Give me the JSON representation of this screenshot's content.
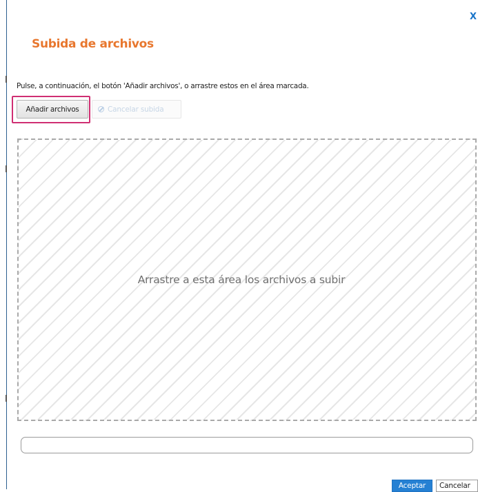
{
  "dialog": {
    "close_label": "X",
    "title": "Subida de archivos",
    "instructions": "Pulse, a continuación, el botón 'Añadir archivos', o arrastre estos en el área marcada."
  },
  "toolbar": {
    "add_files_label": "Añadir archivos",
    "cancel_upload_label": "Cancelar subida",
    "cancel_upload_icon": "ban-icon"
  },
  "dropzone": {
    "label": "Arrastre a esta área los archivos a subir"
  },
  "progress": {
    "value": 0
  },
  "footer": {
    "accept_label": "Aceptar",
    "cancel_label": "Cancelar"
  },
  "colors": {
    "title": "#e8772e",
    "accent": "#2580d3",
    "highlight": "#cf2e72",
    "close": "#1a75c9"
  }
}
